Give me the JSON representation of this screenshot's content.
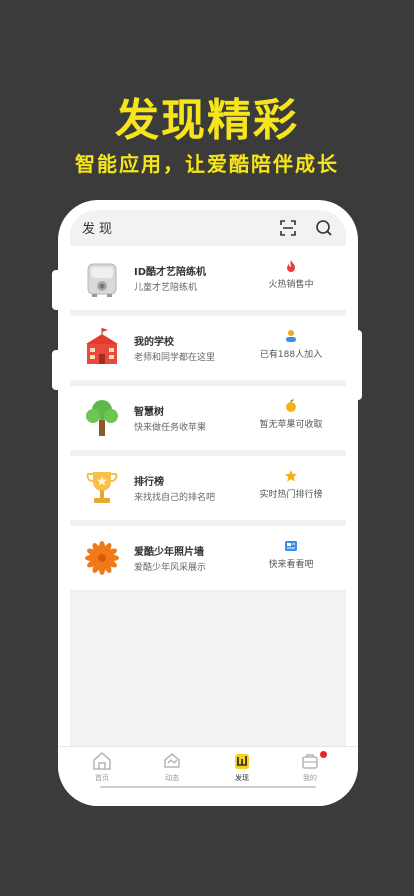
{
  "promo": {
    "headline": "发现精彩",
    "subline": "智能应用，让爱酷陪伴成长"
  },
  "header": {
    "title": "发现"
  },
  "cards": [
    {
      "title": "ID酷才艺陪练机",
      "subtitle": "儿童才艺陪练机",
      "status": "火热销售中",
      "icon": "practice-machine-icon",
      "status_icon": "fire-icon"
    },
    {
      "title": "我的学校",
      "subtitle": "老师和同学都在这里",
      "status": "已有188人加入",
      "icon": "school-icon",
      "status_icon": "people-icon"
    },
    {
      "title": "智慧树",
      "subtitle": "快来做任务收苹果",
      "status": "暂无苹果可收取",
      "icon": "tree-icon",
      "status_icon": "apple-icon"
    },
    {
      "title": "排行榜",
      "subtitle": "来找找自己的排名吧",
      "status": "实时热门排行榜",
      "icon": "trophy-icon",
      "status_icon": "star-icon"
    },
    {
      "title": "爱酷少年照片墙",
      "subtitle": "爱酷少年风采展示",
      "status": "快来看看吧",
      "icon": "flower-icon",
      "status_icon": "photo-icon"
    }
  ],
  "nav": {
    "items": [
      {
        "label": "首页",
        "icon": "home-icon"
      },
      {
        "label": "动态",
        "icon": "feed-icon"
      },
      {
        "label": "发现",
        "icon": "discover-icon",
        "active": true
      },
      {
        "label": "我的",
        "icon": "profile-icon",
        "badge": true
      }
    ]
  },
  "colors": {
    "background": "#3b3b3b",
    "accent": "#f6e51a",
    "content_bg": "#f2f2f2"
  }
}
